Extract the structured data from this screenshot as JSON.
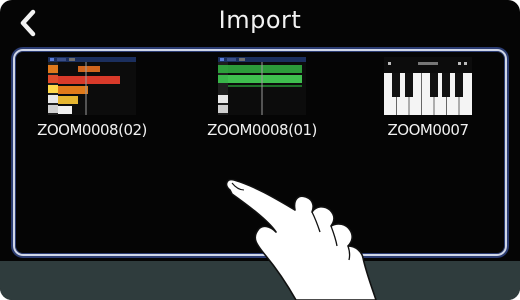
{
  "header": {
    "title": "Import",
    "back_icon": "chevron-left-icon"
  },
  "files": [
    {
      "name": "ZOOM0008(02)",
      "thumbnail": "project-tracks-thumbnail"
    },
    {
      "name": "ZOOM0008(01)",
      "thumbnail": "project-tracks-thumbnail"
    },
    {
      "name": "ZOOM0007",
      "thumbnail": "piano-keyboard-thumbnail"
    }
  ],
  "colors": {
    "background": "#050505",
    "frame_border": "#cfd6e8",
    "frame_glow": "#2b3c72",
    "bottom_bar": "#2f3c3d",
    "text": "#f0f0f0"
  }
}
